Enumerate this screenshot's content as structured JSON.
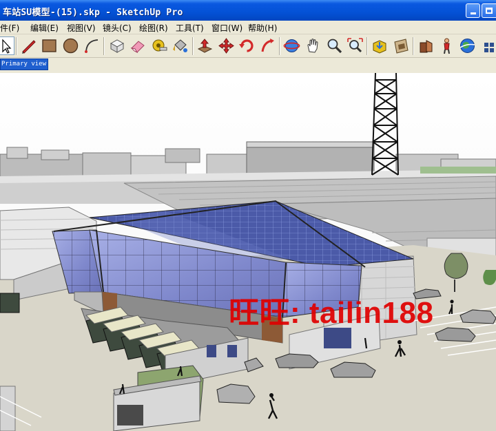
{
  "window": {
    "title": "车站SU模型-(15).skp - SketchUp Pro",
    "buttons": {
      "minimize_icon": "minimize-icon",
      "maximize_icon": "maximize-icon"
    }
  },
  "menu": [
    {
      "label": "文件(F)"
    },
    {
      "label": "编辑(E)"
    },
    {
      "label": "视图(V)"
    },
    {
      "label": "镜头(C)"
    },
    {
      "label": "绘图(R)"
    },
    {
      "label": "工具(T)"
    },
    {
      "label": "窗口(W)"
    },
    {
      "label": "帮助(H)"
    }
  ],
  "toolbar": {
    "tools": [
      {
        "icon": "select-arrow-icon"
      },
      {
        "icon": "pencil-line-icon"
      },
      {
        "icon": "rectangle-icon"
      },
      {
        "icon": "circle-icon"
      },
      {
        "icon": "arc-icon"
      },
      {
        "icon": "make-component-icon"
      },
      {
        "icon": "eraser-icon"
      },
      {
        "icon": "tape-measure-icon"
      },
      {
        "icon": "paint-bucket-icon"
      },
      {
        "icon": "push-pull-icon"
      },
      {
        "icon": "move-icon"
      },
      {
        "icon": "rotate-icon"
      },
      {
        "icon": "follow-me-icon"
      },
      {
        "icon": "orbit-icon"
      },
      {
        "icon": "pan-hand-icon"
      },
      {
        "icon": "zoom-icon"
      },
      {
        "icon": "zoom-extents-icon"
      },
      {
        "icon": "get-models-icon"
      },
      {
        "icon": "share-model-icon"
      },
      {
        "icon": "3d-warehouse-icon"
      },
      {
        "icon": "position-camera-icon"
      },
      {
        "icon": "google-earth-icon"
      },
      {
        "icon": "more-tools-icon"
      }
    ]
  },
  "scene_tab": {
    "label": "Primary view"
  },
  "watermark": {
    "text": "旺旺: tailin188",
    "color": "#e00000"
  },
  "colors": {
    "titlebar": "#0452d6",
    "chrome": "#ece9d8",
    "glass": "#8f9ad6",
    "ground": "#d9d6c9"
  }
}
